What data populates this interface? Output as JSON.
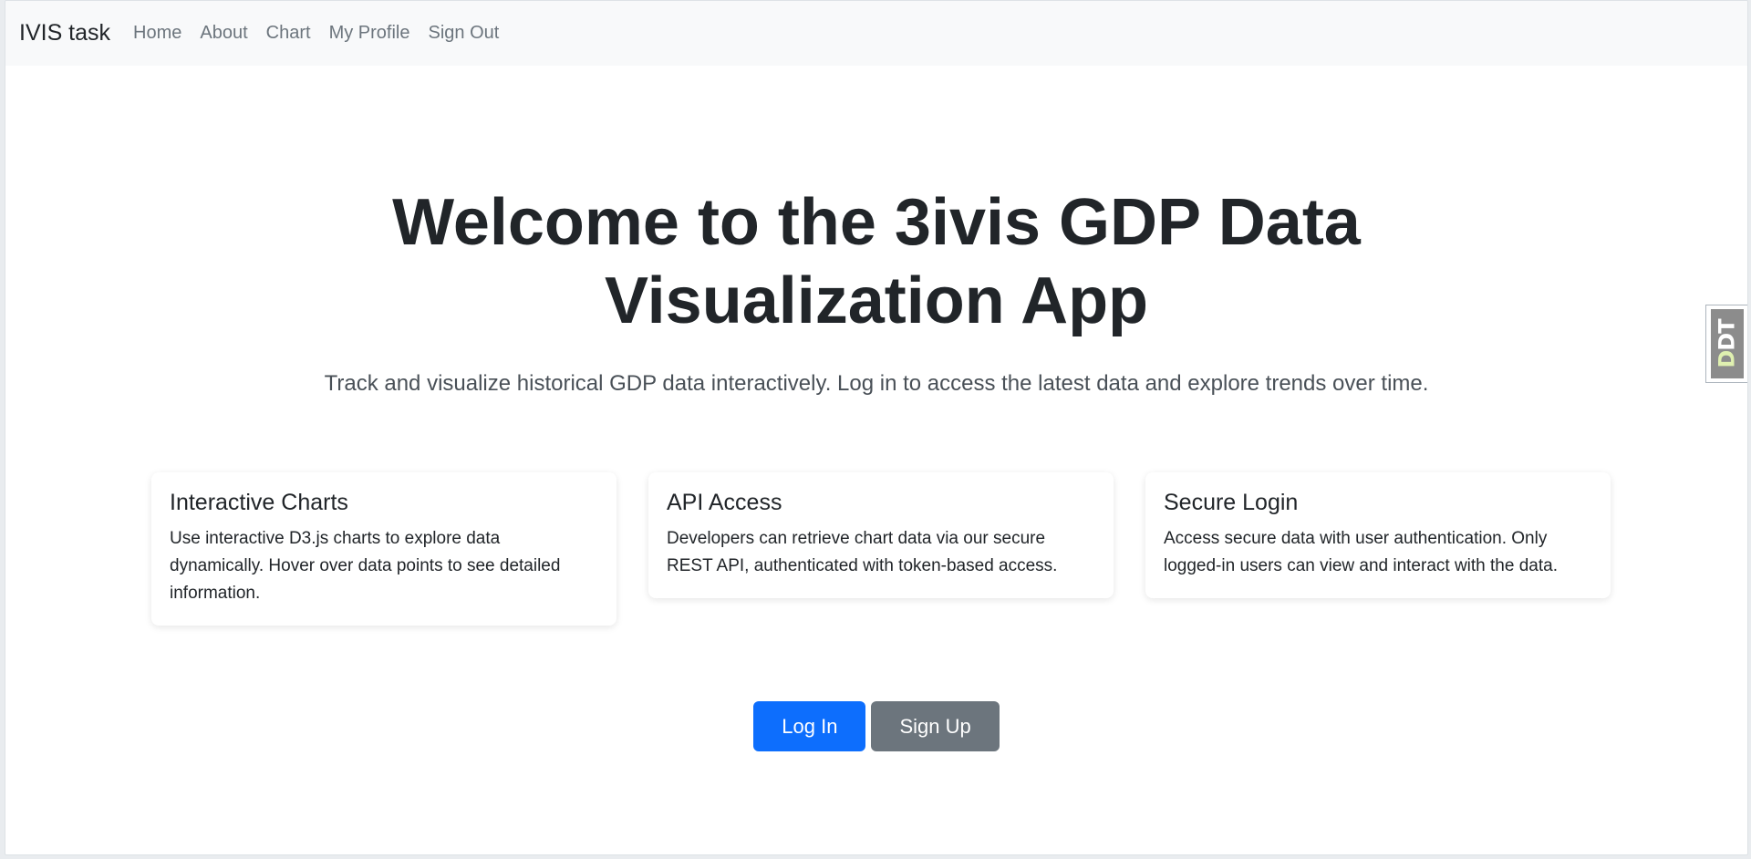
{
  "navbar": {
    "brand": "IVIS task",
    "links": [
      "Home",
      "About",
      "Chart",
      "My Profile",
      "Sign Out"
    ]
  },
  "hero": {
    "title": "Welcome to the 3ivis GDP Data Visualization App",
    "lead": "Track and visualize historical GDP data interactively. Log in to access the latest data and explore trends over time."
  },
  "cards": [
    {
      "title": "Interactive Charts",
      "text": "Use interactive D3.js charts to explore data dynamically. Hover over data points to see detailed information."
    },
    {
      "title": "API Access",
      "text": "Developers can retrieve chart data via our secure REST API, authenticated with token-based access."
    },
    {
      "title": "Secure Login",
      "text": "Access secure data with user authentication. Only logged-in users can view and interact with the data."
    }
  ],
  "buttons": {
    "login": "Log In",
    "signup": "Sign Up"
  },
  "side_badge": {
    "prefix": "D",
    "suffix": "DT",
    "icon": "django-debug-toolbar-icon"
  },
  "colors": {
    "primary": "#0d6efd",
    "secondary": "#6c757d",
    "navbar_bg": "#f8f9fa",
    "text": "#212529"
  }
}
